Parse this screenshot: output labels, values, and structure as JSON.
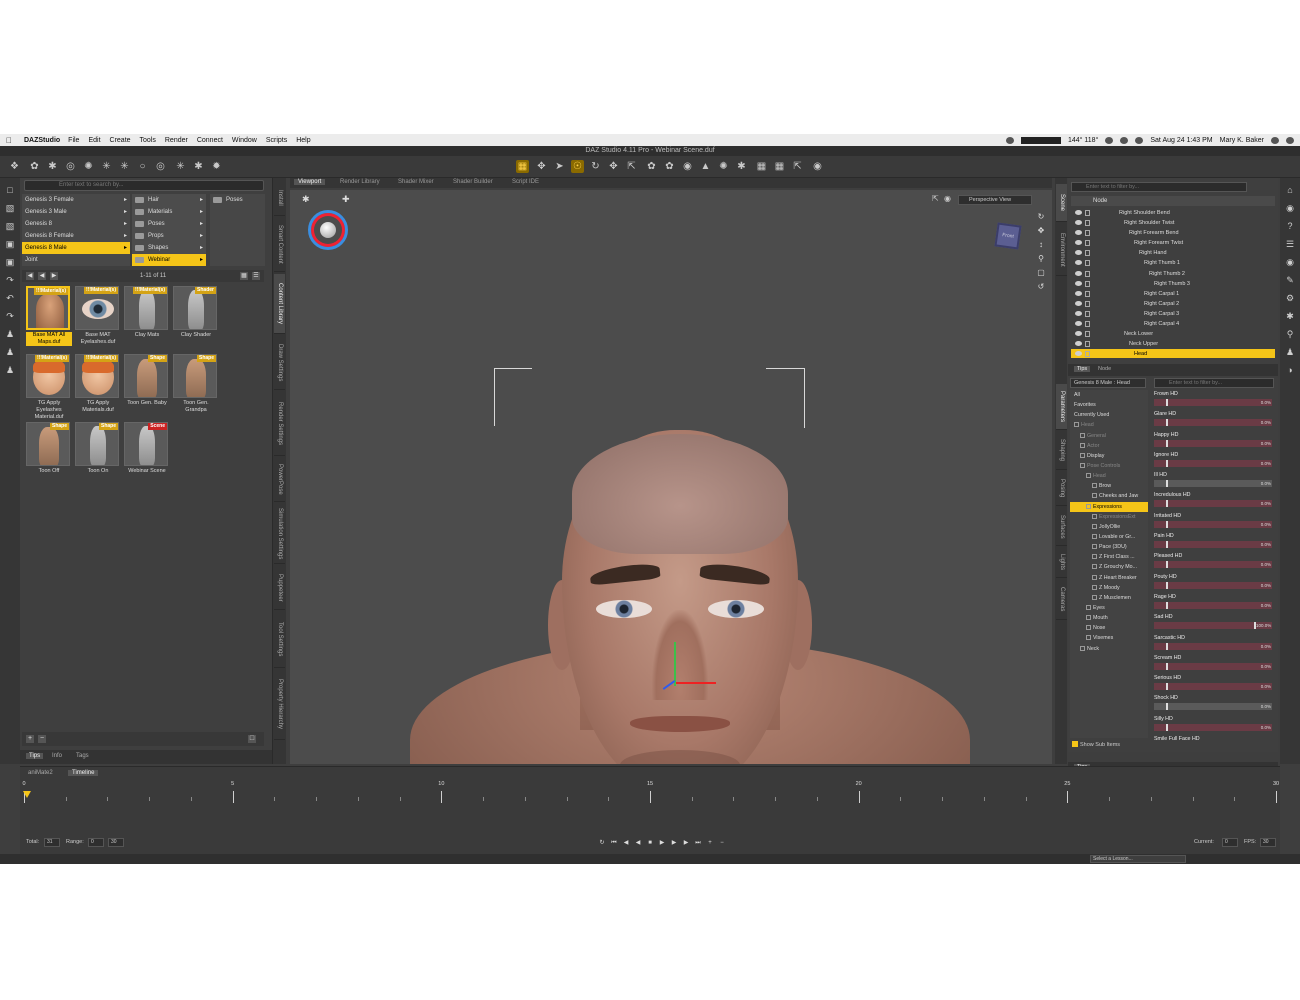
{
  "mac_menubar": {
    "app_name": "DAZStudio",
    "menus": [
      "File",
      "Edit",
      "Create",
      "Tools",
      "Render",
      "Connect",
      "Window",
      "Scripts",
      "Help"
    ],
    "status_temp": "144° 118°",
    "clock": "Sat Aug 24  1:43 PM",
    "user": "Mary K. Baker"
  },
  "window_title": "DAZ Studio 4.11 Pro - Webinar Scene.duf",
  "content_library": {
    "search_placeholder": "Enter text to search by...",
    "tree": [
      {
        "label": "Genesis 3 Female",
        "selected": false
      },
      {
        "label": "Genesis 3 Male",
        "selected": false
      },
      {
        "label": "Genesis 8",
        "selected": false
      },
      {
        "label": "Genesis 8 Female",
        "selected": false
      },
      {
        "label": "Genesis 8 Male",
        "selected": true
      },
      {
        "label": "Joint",
        "selected": false
      }
    ],
    "submenu": [
      {
        "label": "Hair",
        "selected": false
      },
      {
        "label": "Materials",
        "selected": false
      },
      {
        "label": "Poses",
        "selected": false
      },
      {
        "label": "Props",
        "selected": false
      },
      {
        "label": "Shapes",
        "selected": false
      },
      {
        "label": "Webinar",
        "selected": true
      }
    ],
    "subfolder": [
      "Poses"
    ],
    "page_count": "1-11 of 11",
    "items": [
      {
        "caption": "Base MAT All Maps.duf",
        "tag": "!!!Material(s)",
        "kind": "skin",
        "selected": true
      },
      {
        "caption": "Base MAT Eyelashes.duf",
        "tag": "!!!Material(s)",
        "kind": "eye",
        "selected": false
      },
      {
        "caption": "Clay Mats",
        "tag": "!!!Material(s)",
        "kind": "gray",
        "selected": false
      },
      {
        "caption": "Clay Shader",
        "tag": "Shader",
        "kind": "gray",
        "selected": false
      },
      {
        "caption": "TG Apply Eyelashes Material.duf",
        "tag": "!!!Material(s)",
        "kind": "cartoon",
        "selected": false
      },
      {
        "caption": "TG Apply Materials.duf",
        "tag": "!!!Material(s)",
        "kind": "cartoon",
        "selected": false
      },
      {
        "caption": "Toon Gen. Baby",
        "tag": "Shape",
        "kind": "body",
        "selected": false
      },
      {
        "caption": "Toon Gen. Grandpa",
        "tag": "Shape",
        "kind": "body",
        "selected": false
      },
      {
        "caption": "Toon Off",
        "tag": "Shape",
        "kind": "body",
        "selected": false
      },
      {
        "caption": "Toon On",
        "tag": "Shape",
        "kind": "gray",
        "selected": false
      },
      {
        "caption": "Webinar Scene",
        "tag": "Scene",
        "kind": "gray",
        "selected": false
      }
    ],
    "bottom_tabs": [
      "Tips",
      "Info",
      "Tags"
    ]
  },
  "left_vertical_tabs": [
    "Install",
    "Smart Content",
    "Content Library",
    "Draw Settings",
    "Render Settings",
    "PowerPose",
    "Simulation Settings",
    "Puppeteer",
    "Tool Settings",
    "Property Hierarchy"
  ],
  "viewport": {
    "tabs": [
      "Viewport",
      "Render Library",
      "Shader Mixer",
      "Shader Builder",
      "Script IDE"
    ],
    "active_tab": "Viewport",
    "camera": "Perspective View",
    "navcube_label": "Front"
  },
  "scene": {
    "search_placeholder": "Enter text to filter by...",
    "column_header": "Node",
    "nodes": [
      {
        "label": "Right Shoulder Bend",
        "indent": 0,
        "selected": false
      },
      {
        "label": "Right Shoulder Twist",
        "indent": 1,
        "selected": false
      },
      {
        "label": "Right Forearm Bend",
        "indent": 2,
        "selected": false
      },
      {
        "label": "Right Forearm Twist",
        "indent": 3,
        "selected": false
      },
      {
        "label": "Right Hand",
        "indent": 4,
        "selected": false
      },
      {
        "label": "Right Thumb 1",
        "indent": 5,
        "selected": false
      },
      {
        "label": "Right Thumb 2",
        "indent": 6,
        "selected": false
      },
      {
        "label": "Right Thumb 3",
        "indent": 7,
        "selected": false
      },
      {
        "label": "Right Carpal 1",
        "indent": 5,
        "selected": false
      },
      {
        "label": "Right Carpal 2",
        "indent": 5,
        "selected": false
      },
      {
        "label": "Right Carpal 3",
        "indent": 5,
        "selected": false
      },
      {
        "label": "Right Carpal 4",
        "indent": 5,
        "selected": false
      },
      {
        "label": "Neck Lower",
        "indent": 1,
        "selected": false
      },
      {
        "label": "Neck Upper",
        "indent": 2,
        "selected": false
      },
      {
        "label": "Head",
        "indent": 3,
        "selected": true
      }
    ],
    "tabs": [
      "Tips",
      "Node"
    ]
  },
  "right_vertical_tabs": [
    "Scene",
    "Environment"
  ],
  "parameters": {
    "target": "Genesis 8 Male : Head",
    "search_placeholder": "Enter text to filter by...",
    "tree": [
      {
        "label": "All",
        "indent": 0,
        "style": "normal"
      },
      {
        "label": "Favorites",
        "indent": 0,
        "style": "normal"
      },
      {
        "label": "Currently Used",
        "indent": 0,
        "style": "normal"
      },
      {
        "label": "Head",
        "indent": 0,
        "style": "dim"
      },
      {
        "label": "General",
        "indent": 1,
        "style": "dim"
      },
      {
        "label": "Actor",
        "indent": 1,
        "style": "dim"
      },
      {
        "label": "Display",
        "indent": 1,
        "style": "normal"
      },
      {
        "label": "Pose Controls",
        "indent": 1,
        "style": "dim"
      },
      {
        "label": "Head",
        "indent": 2,
        "style": "dim"
      },
      {
        "label": "Brow",
        "indent": 3,
        "style": "normal"
      },
      {
        "label": "Cheeks and Jaw",
        "indent": 3,
        "style": "normal"
      },
      {
        "label": "Expressions",
        "indent": 2,
        "style": "sel"
      },
      {
        "label": "ExpressionsExt",
        "indent": 3,
        "style": "dim"
      },
      {
        "label": "JollyOllie",
        "indent": 3,
        "style": "normal"
      },
      {
        "label": "Lovable or Gr...",
        "indent": 3,
        "style": "normal"
      },
      {
        "label": "Pace (3DU)",
        "indent": 3,
        "style": "normal"
      },
      {
        "label": "Z First Class ...",
        "indent": 3,
        "style": "normal"
      },
      {
        "label": "Z Grouchy Mo...",
        "indent": 3,
        "style": "normal"
      },
      {
        "label": "Z Heart Breaker",
        "indent": 3,
        "style": "normal"
      },
      {
        "label": "Z Moody",
        "indent": 3,
        "style": "normal"
      },
      {
        "label": "Z Musclemen",
        "indent": 3,
        "style": "normal"
      },
      {
        "label": "Eyes",
        "indent": 2,
        "style": "normal"
      },
      {
        "label": "Mouth",
        "indent": 2,
        "style": "normal"
      },
      {
        "label": "Nose",
        "indent": 2,
        "style": "normal"
      },
      {
        "label": "Visemes",
        "indent": 2,
        "style": "normal"
      },
      {
        "label": "Neck",
        "indent": 1,
        "style": "normal"
      }
    ],
    "show_sub_items": "Show Sub Items",
    "sliders": [
      {
        "label": "Frown HD",
        "value": "0.0%",
        "fraction": 0.0
      },
      {
        "label": "Glare HD",
        "value": "0.0%",
        "fraction": 0.0
      },
      {
        "label": "Happy HD",
        "value": "0.0%",
        "fraction": 0.0
      },
      {
        "label": "Ignore HD",
        "value": "0.0%",
        "fraction": 0.0
      },
      {
        "label": "Ill HD",
        "value": "0.0%",
        "fraction": 0.0
      },
      {
        "label": "Incredulous HD",
        "value": "0.0%",
        "fraction": 0.0
      },
      {
        "label": "Irritated HD",
        "value": "0.0%",
        "fraction": 0.0
      },
      {
        "label": "Pain HD",
        "value": "0.0%",
        "fraction": 0.0
      },
      {
        "label": "Pleased HD",
        "value": "0.0%",
        "fraction": 0.0
      },
      {
        "label": "Pouty HD",
        "value": "0.0%",
        "fraction": 0.0
      },
      {
        "label": "Rage HD",
        "value": "0.0%",
        "fraction": 0.0
      },
      {
        "label": "Sad HD",
        "value": "100.0%",
        "fraction": 1.0
      },
      {
        "label": "Sarcastic HD",
        "value": "0.0%",
        "fraction": 0.0
      },
      {
        "label": "Scream HD",
        "value": "0.0%",
        "fraction": 0.0
      },
      {
        "label": "Serious HD",
        "value": "0.0%",
        "fraction": 0.0
      },
      {
        "label": "Shock HD",
        "value": "0.0%",
        "fraction": 0.0
      },
      {
        "label": "Silly HD",
        "value": "0.0%",
        "fraction": 0.0
      },
      {
        "label": "Smile Full Face HD",
        "value": "",
        "fraction": 0.0
      }
    ],
    "bottom_tab": "Tips"
  },
  "param_vertical_tabs": [
    "Parameters",
    "Shaping",
    "Posing",
    "Surfaces",
    "Lights",
    "Cameras"
  ],
  "timeline": {
    "tabs": [
      "aniMate2",
      "Timeline"
    ],
    "active_tab": "Timeline",
    "ticks": [
      0,
      5,
      10,
      15,
      20,
      25,
      30
    ],
    "total_label": "Total:",
    "total": "31",
    "range_label": "Range:",
    "range_start": "0",
    "range_end": "30",
    "current_label": "Current:",
    "current": "0",
    "fps_label": "FPS:",
    "fps": "30"
  },
  "lesson_select": "Select a Lesson..."
}
